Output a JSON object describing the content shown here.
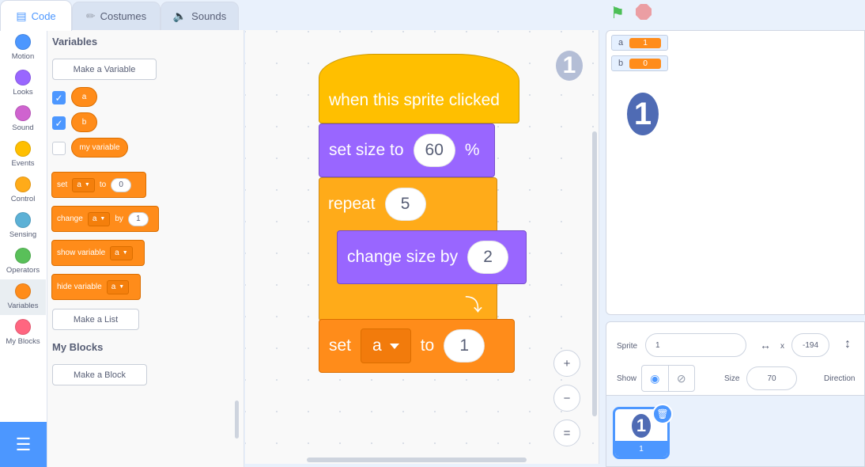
{
  "tabs": [
    {
      "label": "Code",
      "icon": "code-icon"
    },
    {
      "label": "Costumes",
      "icon": "paintbrush-icon"
    },
    {
      "label": "Sounds",
      "icon": "speaker-icon"
    }
  ],
  "categories": [
    {
      "label": "Motion",
      "color": "#4c97ff"
    },
    {
      "label": "Looks",
      "color": "#9966ff"
    },
    {
      "label": "Sound",
      "color": "#cf63cf"
    },
    {
      "label": "Events",
      "color": "#ffbf00"
    },
    {
      "label": "Control",
      "color": "#ffab19"
    },
    {
      "label": "Sensing",
      "color": "#5cb1d6"
    },
    {
      "label": "Operators",
      "color": "#59c059"
    },
    {
      "label": "Variables",
      "color": "#ff8c1a"
    },
    {
      "label": "My Blocks",
      "color": "#ff6680"
    }
  ],
  "palette": {
    "variables_heading": "Variables",
    "make_variable": "Make a Variable",
    "vars": [
      {
        "name": "a",
        "checked": true
      },
      {
        "name": "b",
        "checked": true
      },
      {
        "name": "my variable",
        "checked": false
      }
    ],
    "set_block": {
      "label": "set",
      "var": "a",
      "to": "to",
      "value": "0"
    },
    "change_block": {
      "label": "change",
      "var": "a",
      "by": "by",
      "value": "1"
    },
    "show_block": {
      "label": "show variable",
      "var": "a"
    },
    "hide_block": {
      "label": "hide variable",
      "var": "a"
    },
    "make_list": "Make a List",
    "myblocks_heading": "My Blocks",
    "make_block": "Make a Block"
  },
  "script": {
    "sprite_badge": "1",
    "hat": "when this sprite clicked",
    "set_size": {
      "label": "set size to",
      "value": "60",
      "unit": "%"
    },
    "repeat": {
      "label": "repeat",
      "value": "5"
    },
    "change_size": {
      "label": "change size by",
      "value": "2"
    },
    "set_var": {
      "label": "set",
      "var": "a",
      "to": "to",
      "value": "1"
    },
    "zoom_in": "+",
    "zoom_out": "−",
    "zoom_reset": "="
  },
  "stage": {
    "monitors": [
      {
        "name": "a",
        "value": "1"
      },
      {
        "name": "b",
        "value": "0"
      }
    ],
    "sprite_glyph": "1"
  },
  "sprite_info": {
    "sprite_label": "Sprite",
    "sprite_name": "1",
    "x_label": "x",
    "x_value": "-194",
    "show_label": "Show",
    "size_label": "Size",
    "size_value": "70",
    "direction_label": "Direction"
  },
  "sprite_list": {
    "thumb_glyph": "1",
    "thumb_name": "1"
  }
}
